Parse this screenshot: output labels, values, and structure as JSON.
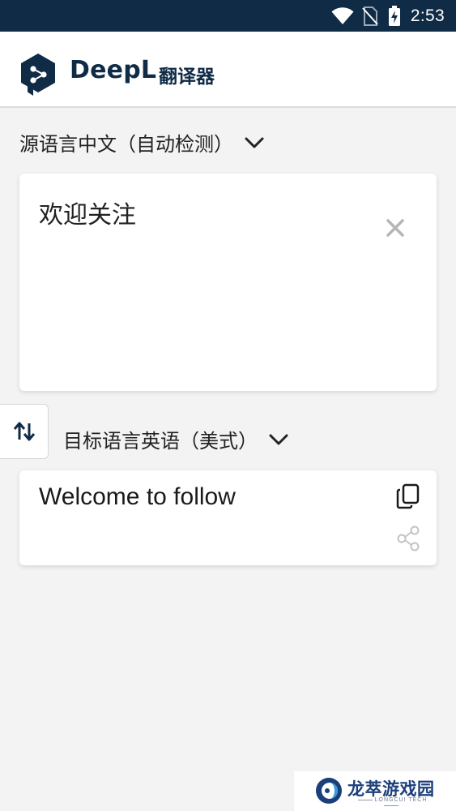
{
  "status_bar": {
    "time": "2:53",
    "icons": [
      "wifi-icon",
      "no-sim-icon",
      "battery-charging-icon"
    ]
  },
  "header": {
    "brand": "DeepL",
    "brand_suffix": "翻译器",
    "logo_icon": "deepl-logo-icon"
  },
  "source": {
    "language_label": "源语言中文（自动检测）",
    "text": "欢迎关注",
    "clear_icon": "close-icon"
  },
  "swap": {
    "icon": "swap-arrows-icon"
  },
  "target": {
    "language_label": "目标语言英语（美式）",
    "text": "Welcome to follow",
    "copy_icon": "copy-icon",
    "share_icon": "share-icon"
  },
  "watermark": {
    "title": "龙萃游戏园",
    "subtitle": "LONGCUI TECH"
  },
  "colors": {
    "status_bar": "#0f2b46",
    "brand": "#0f2b46",
    "background": "#f3f3f3",
    "card": "#ffffff",
    "watermark_title": "#1b3f7a"
  }
}
